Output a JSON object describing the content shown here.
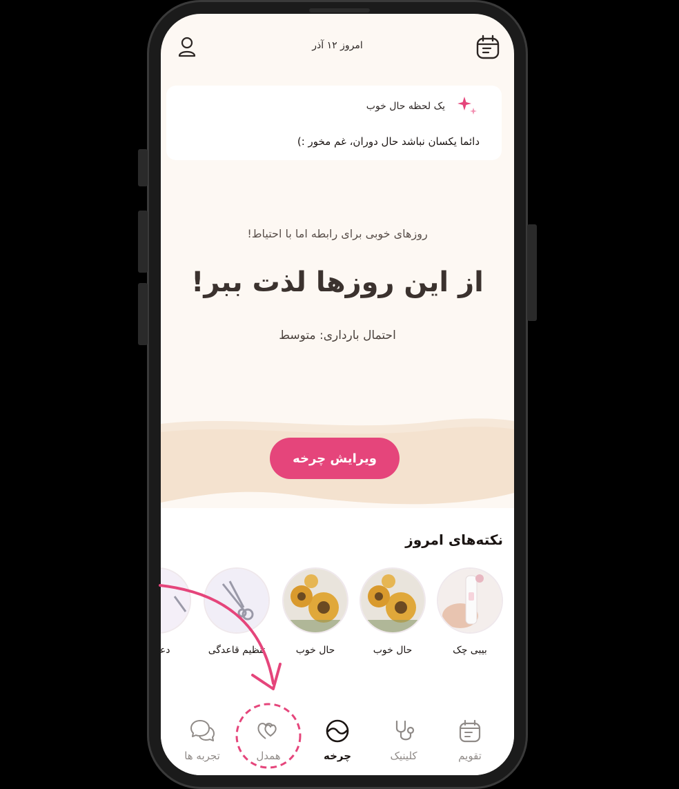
{
  "header": {
    "date_title": "امروز ۱۲ آذر",
    "icons": [
      "profile-icon",
      "calendar-icon"
    ]
  },
  "mood_card": {
    "title": "یک لحظه حال خوب",
    "quote": "دائما یکسان نباشد حال دوران، غم مخور :)",
    "icon": "sparkle-icon"
  },
  "hero": {
    "subtitle": "روزهای خوبی برای رابطه اما با احتیاط!",
    "title": "از این روزها لذت ببر!",
    "probability": "احتمال بارداری: متوسط",
    "edit_button": "ویرایش چرخه"
  },
  "tips": {
    "title": "نکته‌های امروز",
    "items": [
      {
        "label": "بیبی چک",
        "icon": "pregnancy-test-image"
      },
      {
        "label": "حال خوب",
        "icon": "sunflower-image"
      },
      {
        "label": "حال خوب",
        "icon": "sunflower-image"
      },
      {
        "label": "تنظیم قاعدگی",
        "icon": "scissors-image"
      },
      {
        "label": "دعوت",
        "icon": "invite-image"
      }
    ]
  },
  "nav": {
    "items": [
      {
        "label": "تقویم",
        "icon": "calendar-icon",
        "active": false
      },
      {
        "label": "کلینیک",
        "icon": "stethoscope-icon",
        "active": false
      },
      {
        "label": "چرخه",
        "icon": "cycle-icon",
        "active": true
      },
      {
        "label": "همدل",
        "icon": "hearts-icon",
        "active": false
      },
      {
        "label": "تجربه ها",
        "icon": "chat-bubbles-icon",
        "active": false
      }
    ]
  },
  "colors": {
    "accent": "#e5457b",
    "annotation": "#e5457b",
    "background": "#fdf8f3",
    "wave": "#f5e6d6"
  }
}
